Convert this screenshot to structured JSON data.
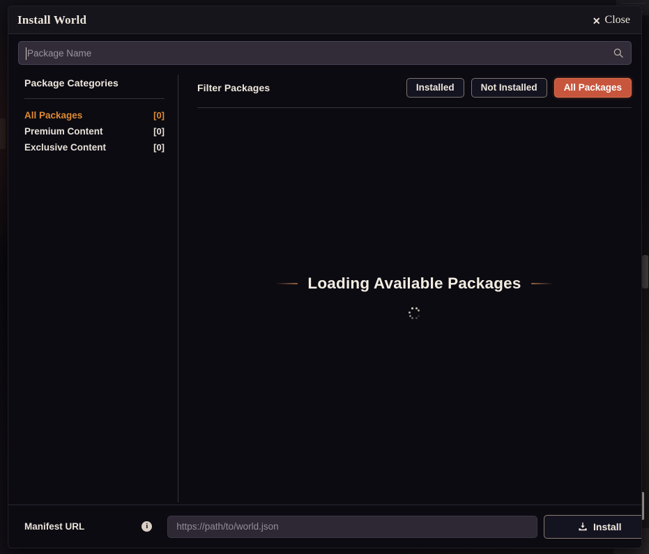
{
  "window": {
    "title": "Install World",
    "close_label": "Close",
    "close_icon": "x-icon"
  },
  "search": {
    "placeholder": "Package Name",
    "value": "",
    "icon": "search-icon"
  },
  "sidebar": {
    "heading": "Package Categories",
    "items": [
      {
        "label": "All Packages",
        "count": "[0]",
        "active": true
      },
      {
        "label": "Premium Content",
        "count": "[0]",
        "active": false
      },
      {
        "label": "Exclusive Content",
        "count": "[0]",
        "active": false
      }
    ]
  },
  "main": {
    "filter_heading": "Filter Packages",
    "filters": [
      {
        "label": "Installed",
        "active": false
      },
      {
        "label": "Not Installed",
        "active": false
      },
      {
        "label": "All Packages",
        "active": true
      }
    ],
    "loading_text": "Loading Available Packages",
    "spinner_icon": "loading-spinner-icon"
  },
  "footer": {
    "manifest_label": "Manifest URL",
    "info_icon": "info-icon",
    "manifest_placeholder": "https://path/to/world.json",
    "manifest_value": "",
    "install_label": "Install",
    "install_icon": "download-icon"
  },
  "colors": {
    "accent": "#e08a33",
    "active_button": "#c7563d",
    "dialog_background": "#0c0b12",
    "titlebar_background": "#16151c",
    "text": "#efe7dc"
  }
}
